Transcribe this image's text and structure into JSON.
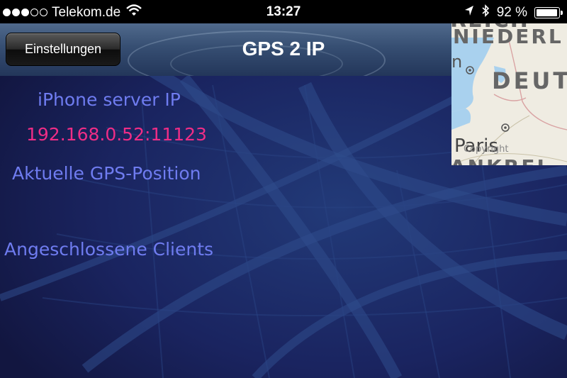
{
  "status_bar": {
    "carrier": "Telekom.de",
    "signal_bars_filled": 3,
    "signal_bars_total": 5,
    "time": "13:27",
    "battery": "92 %"
  },
  "nav_bar": {
    "back_button": "Einstellungen",
    "title": "GPS 2 IP"
  },
  "map": {
    "labels": {
      "top": "REICH",
      "nieder": "NIEDERL",
      "n": "n",
      "deut": "DEUT",
      "paris": "Paris",
      "copyright": "Copyright",
      "frank": "ANKREI"
    }
  },
  "content": {
    "server_label": "iPhone server IP",
    "server_ip": "192.168.0.52:11123",
    "gps_label": "Aktuelle GPS-Position",
    "clients_label": "Angeschlossene Clients"
  },
  "colors": {
    "label": "#6f7cf0",
    "ip": "#ef2d86",
    "background": "#161a4a"
  }
}
